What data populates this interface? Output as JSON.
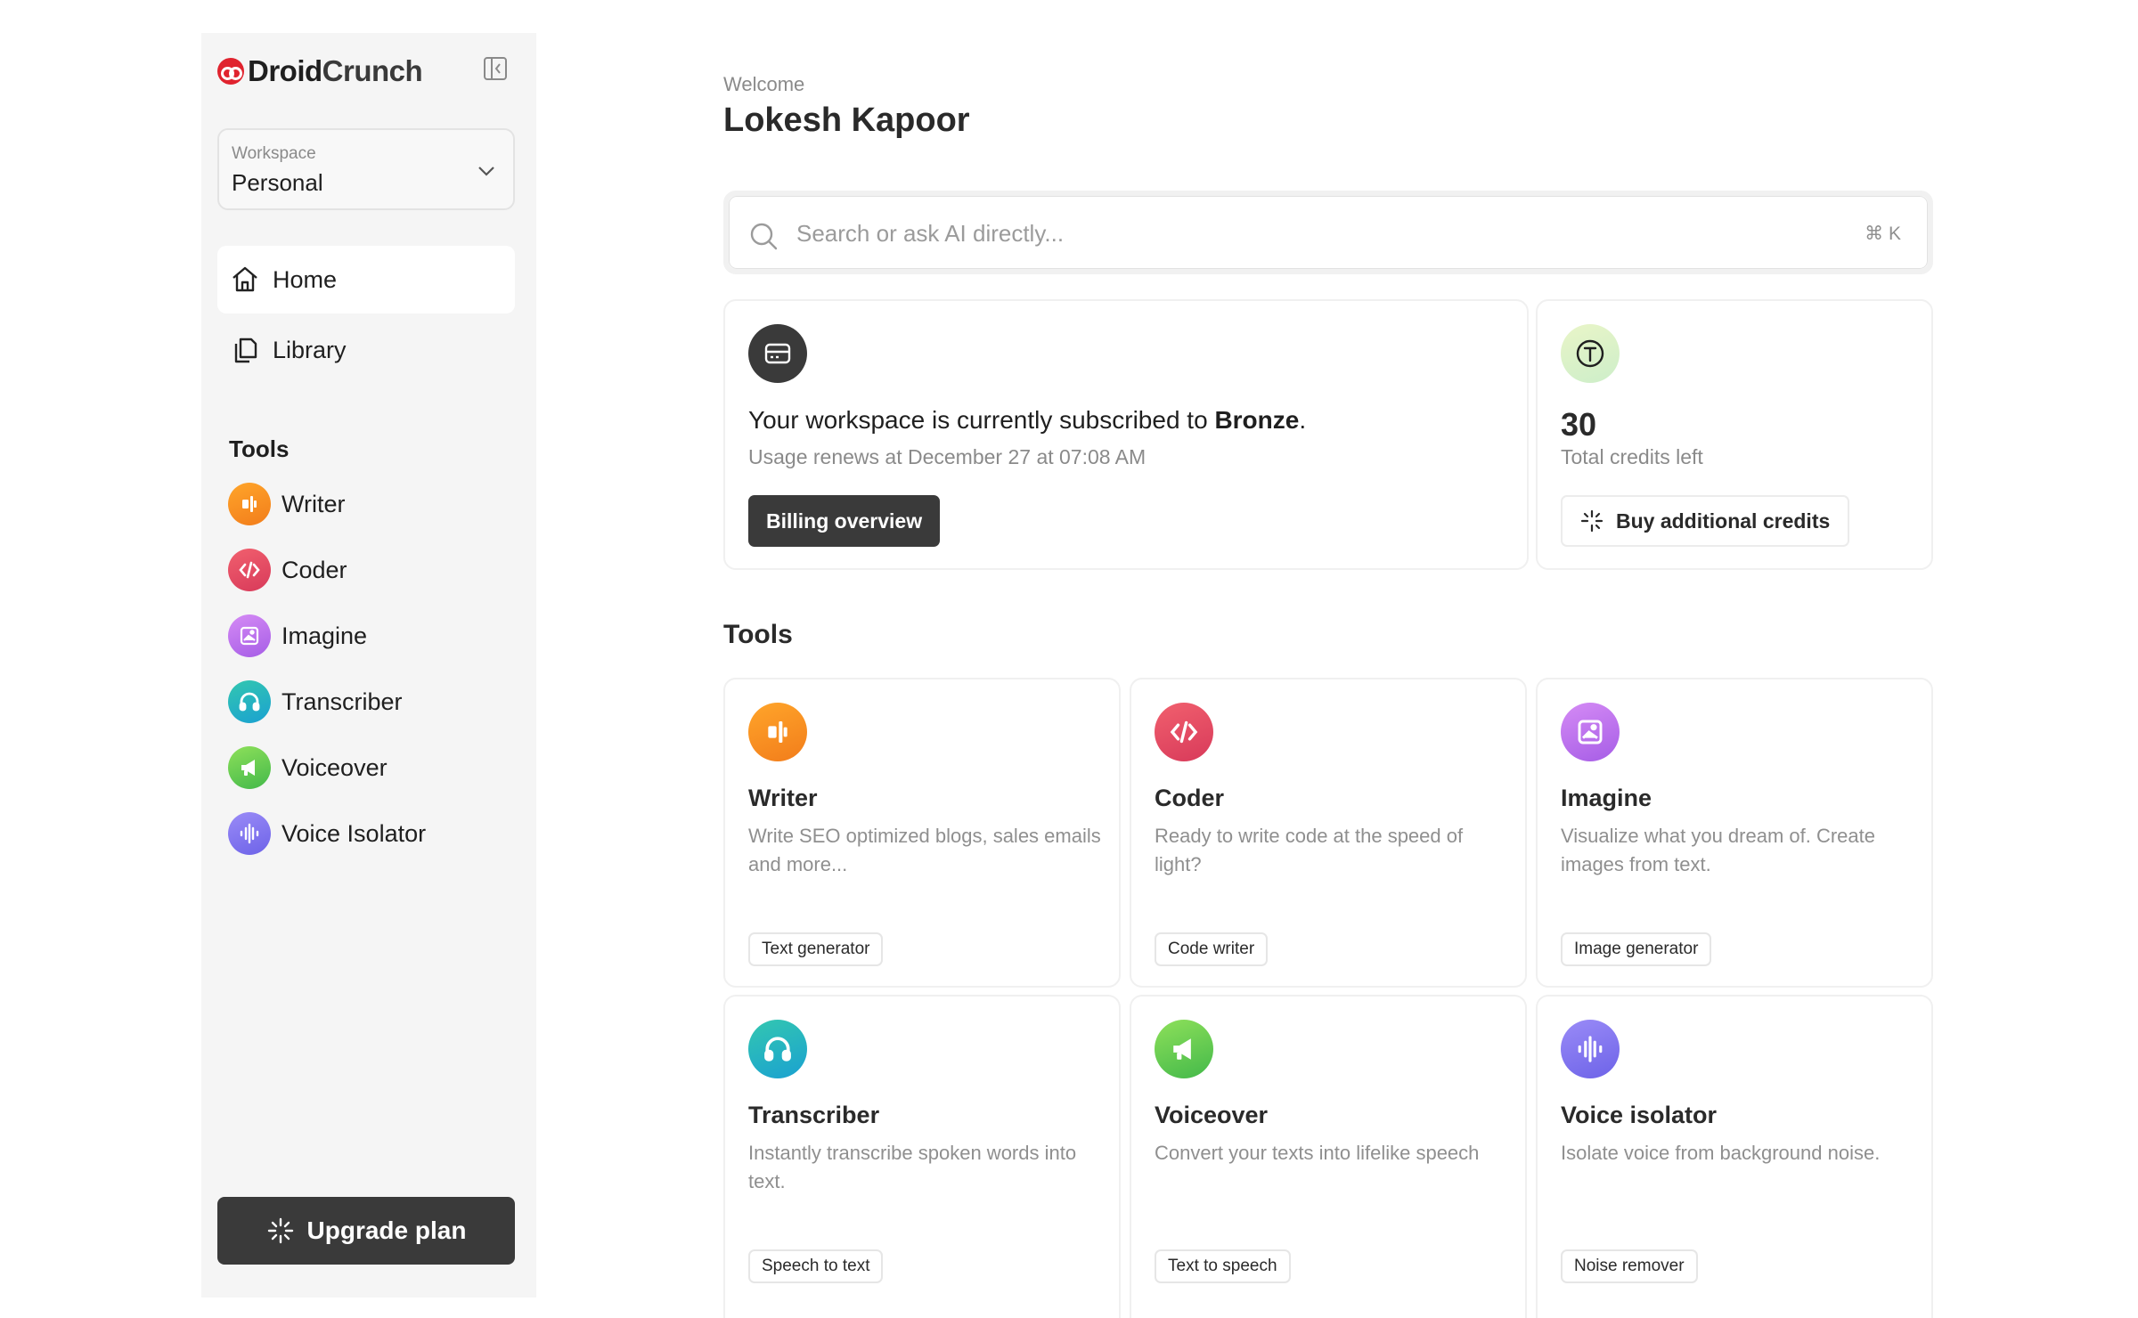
{
  "brand": {
    "name_part1": "Droid",
    "name_part2": "Crunch",
    "accent_color": "#e0232e"
  },
  "sidebar": {
    "workspace": {
      "label": "Workspace",
      "value": "Personal"
    },
    "nav": [
      {
        "label": "Home",
        "icon": "home-icon",
        "active": true
      },
      {
        "label": "Library",
        "icon": "library-icon",
        "active": false
      }
    ],
    "tools_heading": "Tools",
    "tools": [
      {
        "label": "Writer",
        "icon": "writer-icon",
        "color": "#f7921f"
      },
      {
        "label": "Coder",
        "icon": "code-icon",
        "color": "#e24b65"
      },
      {
        "label": "Imagine",
        "icon": "image-icon",
        "color": "#bd74ee"
      },
      {
        "label": "Transcriber",
        "icon": "headphones-icon",
        "color": "#25b4c0"
      },
      {
        "label": "Voiceover",
        "icon": "megaphone-icon",
        "color": "#62c94f"
      },
      {
        "label": "Voice Isolator",
        "icon": "waveform-icon",
        "color": "#8577f0"
      }
    ],
    "upgrade_label": "Upgrade plan"
  },
  "main": {
    "welcome": "Welcome",
    "user_name": "Lokesh Kapoor",
    "search": {
      "placeholder": "Search or ask AI directly...",
      "shortcut": "⌘ K"
    },
    "subscription": {
      "text_prefix": "Your workspace is currently subscribed to ",
      "plan": "Bronze",
      "text_suffix": ".",
      "renewal": "Usage renews at December 27 at 07:08 AM",
      "button": "Billing overview"
    },
    "credits": {
      "value": "30",
      "label": "Total credits left",
      "button": "Buy additional credits"
    },
    "tools_title": "Tools",
    "tool_cards": [
      {
        "title": "Writer",
        "description": "Write SEO optimized blogs, sales emails and more...",
        "tag": "Text generator"
      },
      {
        "title": "Coder",
        "description": "Ready to write code at the speed of light?",
        "tag": "Code writer"
      },
      {
        "title": "Imagine",
        "description": "Visualize what you dream of. Create images from text.",
        "tag": "Image generator"
      },
      {
        "title": "Transcriber",
        "description": "Instantly transcribe spoken words into text.",
        "tag": "Speech to text"
      },
      {
        "title": "Voiceover",
        "description": "Convert your texts into lifelike speech",
        "tag": "Text to speech"
      },
      {
        "title": "Voice isolator",
        "description": "Isolate voice from background noise.",
        "tag": "Noise remover"
      }
    ]
  }
}
